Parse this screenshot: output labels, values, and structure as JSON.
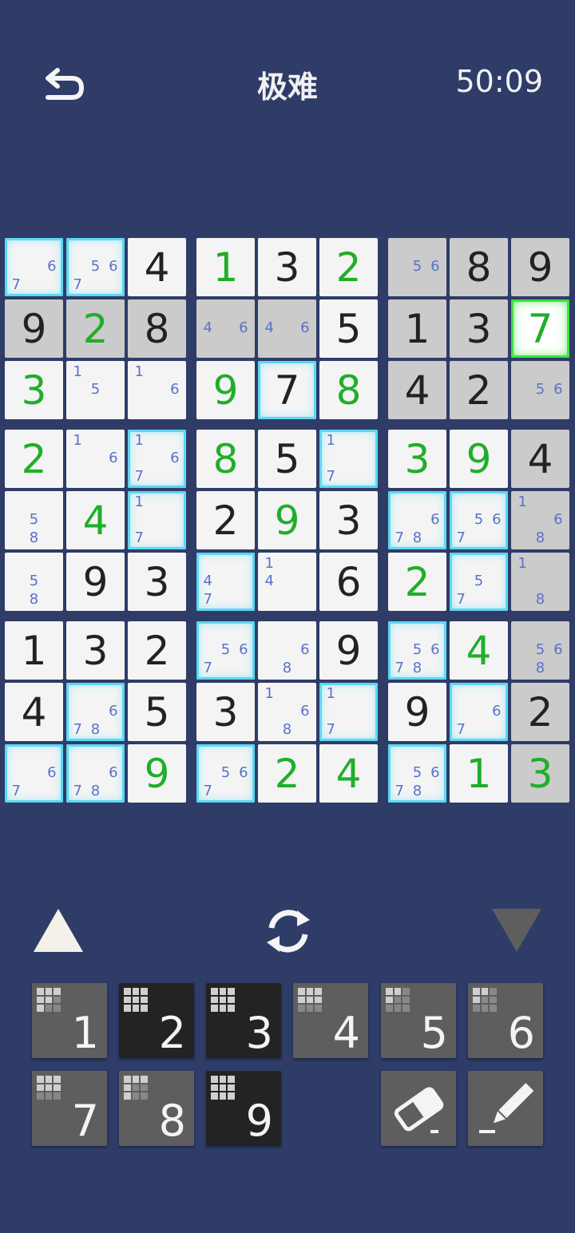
{
  "header": {
    "title": "极难",
    "timer": "50:09"
  },
  "icons": {
    "back": "back-arrow-icon",
    "refresh": "refresh-icon",
    "up": "triangle-up-icon",
    "down": "triangle-down-icon",
    "eraser": "eraser-icon",
    "pencil": "pencil-icon"
  },
  "colors": {
    "background": "#2f3c68",
    "entered": "#1fae2a",
    "notes": "#5a72c8",
    "highlight": "#5fd7f0",
    "selected": "#3fe23f"
  },
  "board": [
    [
      {
        "n": [
          "6",
          "7"
        ],
        "g": false,
        "h": true
      },
      {
        "n": [
          "5",
          "6",
          "7"
        ],
        "g": false,
        "h": true
      },
      {
        "v": "4",
        "t": "given"
      },
      {
        "v": "1",
        "t": "entered"
      },
      {
        "v": "3",
        "t": "given"
      },
      {
        "v": "2",
        "t": "entered"
      },
      {
        "n": [
          "5",
          "6"
        ],
        "g": true
      },
      {
        "v": "8",
        "t": "given",
        "g": true
      },
      {
        "v": "9",
        "t": "given",
        "g": true
      }
    ],
    [
      {
        "v": "9",
        "t": "given",
        "g": true
      },
      {
        "v": "2",
        "t": "entered",
        "g": true
      },
      {
        "v": "8",
        "t": "given",
        "g": true
      },
      {
        "n": [
          "4",
          "6"
        ],
        "g": true
      },
      {
        "n": [
          "4",
          "6"
        ],
        "g": true
      },
      {
        "v": "5",
        "t": "given"
      },
      {
        "v": "1",
        "t": "given",
        "g": true
      },
      {
        "v": "3",
        "t": "given",
        "g": true
      },
      {
        "v": "7",
        "t": "entered",
        "sel": true
      }
    ],
    [
      {
        "v": "3",
        "t": "entered"
      },
      {
        "n": [
          "1",
          "5"
        ]
      },
      {
        "n": [
          "1",
          "6"
        ]
      },
      {
        "v": "9",
        "t": "entered"
      },
      {
        "v": "7",
        "t": "given",
        "h": true
      },
      {
        "v": "8",
        "t": "entered"
      },
      {
        "v": "4",
        "t": "given",
        "g": true
      },
      {
        "v": "2",
        "t": "given",
        "g": true
      },
      {
        "n": [
          "5",
          "6"
        ],
        "g": true
      }
    ],
    [
      {
        "v": "2",
        "t": "entered"
      },
      {
        "n": [
          "1",
          "6"
        ]
      },
      {
        "n": [
          "1",
          "6",
          "7"
        ],
        "h": true
      },
      {
        "v": "8",
        "t": "entered"
      },
      {
        "v": "5",
        "t": "given"
      },
      {
        "n": [
          "1",
          "7"
        ],
        "h": true
      },
      {
        "v": "3",
        "t": "entered"
      },
      {
        "v": "9",
        "t": "entered"
      },
      {
        "v": "4",
        "t": "given",
        "g": true
      }
    ],
    [
      {
        "n": [
          "5",
          "8"
        ]
      },
      {
        "v": "4",
        "t": "entered"
      },
      {
        "n": [
          "1",
          "7"
        ],
        "h": true
      },
      {
        "v": "2",
        "t": "given"
      },
      {
        "v": "9",
        "t": "entered"
      },
      {
        "v": "3",
        "t": "given"
      },
      {
        "n": [
          "6",
          "7",
          "8"
        ],
        "h": true
      },
      {
        "n": [
          "5",
          "6",
          "7"
        ],
        "h": true
      },
      {
        "n": [
          "1",
          "6",
          "8"
        ],
        "g": true
      }
    ],
    [
      {
        "n": [
          "5",
          "8"
        ]
      },
      {
        "v": "9",
        "t": "given"
      },
      {
        "v": "3",
        "t": "given"
      },
      {
        "n": [
          "4",
          "7"
        ],
        "h": true
      },
      {
        "n": [
          "1",
          "4"
        ]
      },
      {
        "v": "6",
        "t": "given"
      },
      {
        "v": "2",
        "t": "entered"
      },
      {
        "n": [
          "5",
          "7"
        ],
        "h": true
      },
      {
        "n": [
          "1",
          "8"
        ],
        "g": true
      }
    ],
    [
      {
        "v": "1",
        "t": "given"
      },
      {
        "v": "3",
        "t": "given"
      },
      {
        "v": "2",
        "t": "given"
      },
      {
        "n": [
          "5",
          "6",
          "7"
        ],
        "h": true
      },
      {
        "n": [
          "6",
          "8"
        ]
      },
      {
        "v": "9",
        "t": "given"
      },
      {
        "n": [
          "5",
          "6",
          "7",
          "8"
        ],
        "h": true
      },
      {
        "v": "4",
        "t": "entered"
      },
      {
        "n": [
          "5",
          "6",
          "8"
        ],
        "g": true
      }
    ],
    [
      {
        "v": "4",
        "t": "given"
      },
      {
        "n": [
          "6",
          "7",
          "8"
        ],
        "h": true
      },
      {
        "v": "5",
        "t": "given"
      },
      {
        "v": "3",
        "t": "given"
      },
      {
        "n": [
          "1",
          "6",
          "8"
        ]
      },
      {
        "n": [
          "1",
          "7"
        ],
        "h": true
      },
      {
        "v": "9",
        "t": "given"
      },
      {
        "n": [
          "6",
          "7"
        ],
        "h": true
      },
      {
        "v": "2",
        "t": "given",
        "g": true
      }
    ],
    [
      {
        "n": [
          "6",
          "7"
        ],
        "h": true
      },
      {
        "n": [
          "6",
          "7",
          "8"
        ],
        "h": true
      },
      {
        "v": "9",
        "t": "entered"
      },
      {
        "n": [
          "5",
          "6",
          "7"
        ],
        "h": true
      },
      {
        "v": "2",
        "t": "entered"
      },
      {
        "v": "4",
        "t": "entered"
      },
      {
        "n": [
          "5",
          "6",
          "7",
          "8"
        ],
        "h": true
      },
      {
        "v": "1",
        "t": "entered"
      },
      {
        "v": "3",
        "t": "entered",
        "g": true
      }
    ]
  ],
  "keypad": [
    {
      "label": "1",
      "dark": false,
      "mini": [
        1,
        1,
        1,
        1,
        1,
        0,
        1,
        0,
        0
      ]
    },
    {
      "label": "2",
      "dark": true,
      "mini": [
        1,
        1,
        1,
        1,
        1,
        1,
        1,
        1,
        1
      ]
    },
    {
      "label": "3",
      "dark": true,
      "mini": [
        1,
        1,
        1,
        1,
        1,
        1,
        1,
        1,
        1
      ]
    },
    {
      "label": "4",
      "dark": false,
      "mini": [
        1,
        1,
        1,
        1,
        1,
        1,
        0,
        0,
        0
      ]
    },
    {
      "label": "5",
      "dark": false,
      "mini": [
        1,
        1,
        0,
        1,
        0,
        0,
        0,
        0,
        0
      ]
    },
    {
      "label": "6",
      "dark": false,
      "mini": [
        1,
        1,
        0,
        1,
        0,
        0,
        0,
        0,
        0
      ]
    },
    {
      "label": "7",
      "dark": false,
      "mini": [
        1,
        1,
        1,
        1,
        1,
        1,
        0,
        0,
        0
      ]
    },
    {
      "label": "8",
      "dark": false,
      "mini": [
        1,
        1,
        1,
        1,
        0,
        0,
        1,
        0,
        0
      ]
    },
    {
      "label": "9",
      "dark": true,
      "mini": [
        1,
        1,
        1,
        1,
        1,
        1,
        1,
        1,
        1
      ]
    }
  ]
}
